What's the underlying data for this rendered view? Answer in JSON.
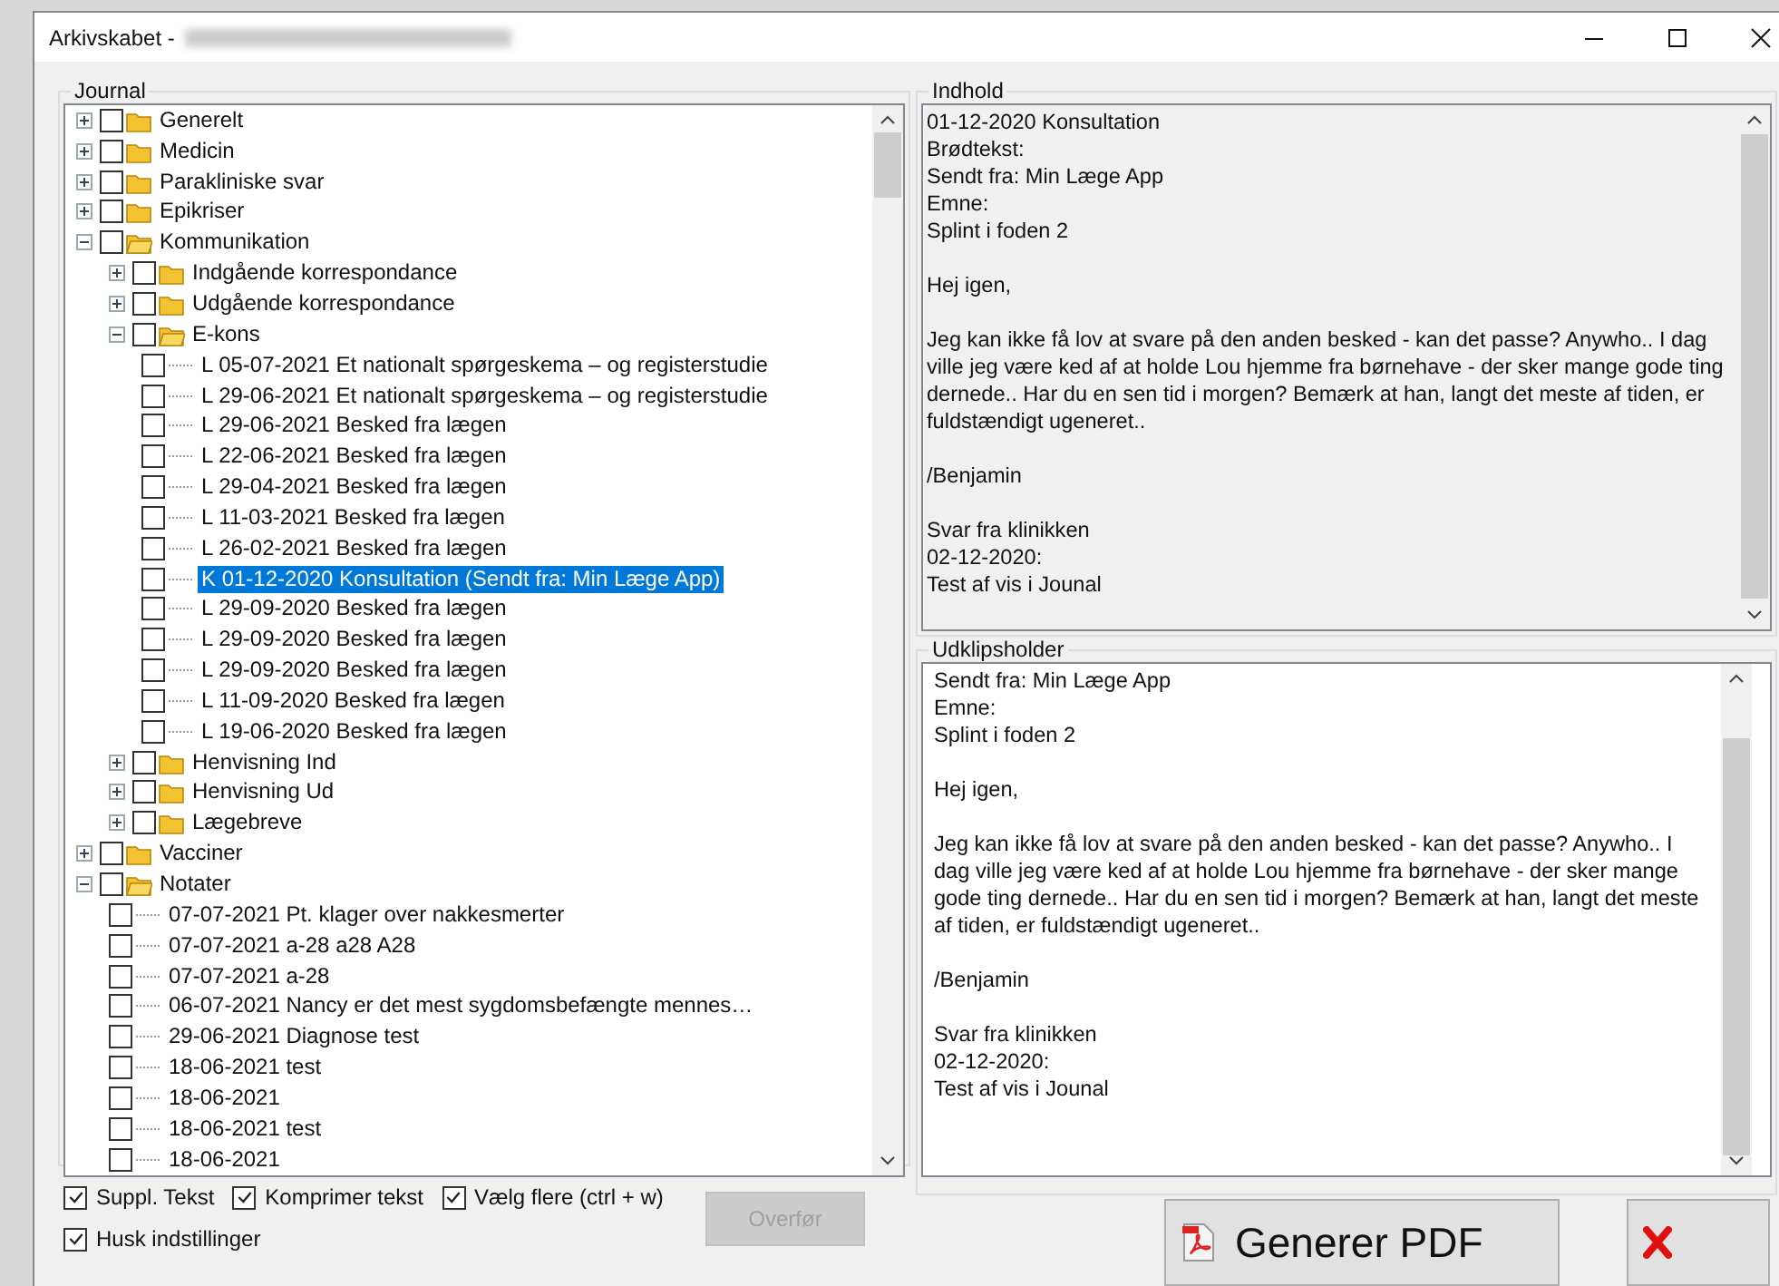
{
  "window": {
    "title": "Arkivskabet -"
  },
  "journal": {
    "label": "Journal",
    "tree": [
      {
        "kind": "folder",
        "label": "Generelt",
        "expanded": false,
        "checked": false,
        "selected": false
      },
      {
        "kind": "folder",
        "label": "Medicin",
        "expanded": false,
        "checked": false,
        "selected": false
      },
      {
        "kind": "folder",
        "label": "Parakliniske svar",
        "expanded": false,
        "checked": false,
        "selected": false
      },
      {
        "kind": "folder",
        "label": "Epikriser",
        "expanded": false,
        "checked": false,
        "selected": false
      },
      {
        "kind": "folder",
        "label": "Kommunikation",
        "expanded": true,
        "checked": false,
        "selected": false,
        "children": [
          {
            "kind": "folder",
            "label": "Indgående korrespondance",
            "expanded": false,
            "checked": false,
            "selected": false
          },
          {
            "kind": "folder",
            "label": "Udgående korrespondance",
            "expanded": false,
            "checked": false,
            "selected": false
          },
          {
            "kind": "folder",
            "label": "E-kons",
            "expanded": true,
            "checked": false,
            "selected": false,
            "children": [
              {
                "kind": "leaf",
                "label": "L 05-07-2021 Et nationalt spørgeskema – og registerstudie",
                "checked": false,
                "selected": false
              },
              {
                "kind": "leaf",
                "label": "L 29-06-2021 Et nationalt spørgeskema – og registerstudie",
                "checked": false,
                "selected": false
              },
              {
                "kind": "leaf",
                "label": "L 29-06-2021 Besked fra lægen",
                "checked": false,
                "selected": false
              },
              {
                "kind": "leaf",
                "label": "L 22-06-2021 Besked fra lægen",
                "checked": false,
                "selected": false
              },
              {
                "kind": "leaf",
                "label": "L 29-04-2021 Besked fra lægen",
                "checked": false,
                "selected": false
              },
              {
                "kind": "leaf",
                "label": "L 11-03-2021 Besked fra lægen",
                "checked": false,
                "selected": false
              },
              {
                "kind": "leaf",
                "label": "L 26-02-2021 Besked fra lægen",
                "checked": false,
                "selected": false
              },
              {
                "kind": "leaf",
                "label": "K 01-12-2020 Konsultation (Sendt fra: Min Læge App)",
                "checked": false,
                "selected": true
              },
              {
                "kind": "leaf",
                "label": "L 29-09-2020 Besked fra lægen",
                "checked": false,
                "selected": false
              },
              {
                "kind": "leaf",
                "label": "L 29-09-2020 Besked fra lægen",
                "checked": false,
                "selected": false
              },
              {
                "kind": "leaf",
                "label": "L 29-09-2020 Besked fra lægen",
                "checked": false,
                "selected": false
              },
              {
                "kind": "leaf",
                "label": "L 11-09-2020 Besked fra lægen",
                "checked": false,
                "selected": false
              },
              {
                "kind": "leaf",
                "label": "L 19-06-2020 Besked fra lægen",
                "checked": false,
                "selected": false
              }
            ]
          },
          {
            "kind": "folder",
            "label": "Henvisning Ind",
            "expanded": false,
            "checked": false,
            "selected": false
          },
          {
            "kind": "folder",
            "label": "Henvisning Ud",
            "expanded": false,
            "checked": false,
            "selected": false
          },
          {
            "kind": "folder",
            "label": "Lægebreve",
            "expanded": false,
            "checked": false,
            "selected": false
          }
        ]
      },
      {
        "kind": "folder",
        "label": "Vacciner",
        "expanded": false,
        "checked": false,
        "selected": false
      },
      {
        "kind": "folder",
        "label": "Notater",
        "expanded": true,
        "checked": false,
        "selected": false,
        "children": [
          {
            "kind": "leaf",
            "label": "07-07-2021 Pt. klager over nakkesmerter",
            "checked": false,
            "selected": false
          },
          {
            "kind": "leaf",
            "label": "07-07-2021 a-28 a28 A28",
            "checked": false,
            "selected": false
          },
          {
            "kind": "leaf",
            "label": "07-07-2021 a-28",
            "checked": false,
            "selected": false
          },
          {
            "kind": "leaf",
            "label": "06-07-2021 Nancy er det mest sygdomsbefængte mennes…",
            "checked": false,
            "selected": false
          },
          {
            "kind": "leaf",
            "label": "29-06-2021 Diagnose test",
            "checked": false,
            "selected": false
          },
          {
            "kind": "leaf",
            "label": "18-06-2021 test",
            "checked": false,
            "selected": false
          },
          {
            "kind": "leaf",
            "label": "18-06-2021",
            "checked": false,
            "selected": false
          },
          {
            "kind": "leaf",
            "label": "18-06-2021 test",
            "checked": false,
            "selected": false
          },
          {
            "kind": "leaf",
            "label": "18-06-2021",
            "checked": false,
            "selected": false
          }
        ]
      }
    ]
  },
  "options": [
    {
      "label": "Suppl. Tekst",
      "checked": true
    },
    {
      "label": "Komprimer tekst",
      "checked": true
    },
    {
      "label": "Vælg flere (ctrl + w)",
      "checked": true
    },
    {
      "label": "Husk indstillinger",
      "checked": true
    }
  ],
  "transfer_button": {
    "label": "Overfør",
    "disabled": true
  },
  "content": {
    "label": "Indhold",
    "paragraphs": [
      "01-12-2020 Konsultation\nBrødtekst:\nSendt fra: Min Læge App\nEmne:\nSplint i foden 2",
      "Hej igen,",
      "Jeg kan ikke få lov at svare på den anden besked - kan det passe? Anywho.. I dag ville jeg være ked af at holde Lou hjemme fra børnehave - der sker mange gode ting dernede.. Har du en sen tid i morgen? Bemærk at han, langt det meste af tiden, er fuldstændigt ugeneret..",
      "/Benjamin",
      "Svar fra klinikken\n02-12-2020:\nTest af vis i Jounal"
    ]
  },
  "clipboard": {
    "label": "Udklipsholder",
    "paragraphs": [
      "Sendt fra: Min Læge App\nEmne:\nSplint i foden 2",
      "Hej igen,",
      "Jeg kan ikke få lov at svare på den anden besked - kan det passe? Anywho.. I dag ville jeg være ked af at holde Lou hjemme fra børnehave - der sker mange gode ting dernede.. Har du en sen tid i morgen? Bemærk at han, langt det meste af tiden, er fuldstændigt ugeneret..",
      "/Benjamin",
      "Svar fra klinikken\n02-12-2020:\nTest af vis i Jounal"
    ]
  },
  "pdf_button": {
    "label": "Generer PDF"
  }
}
